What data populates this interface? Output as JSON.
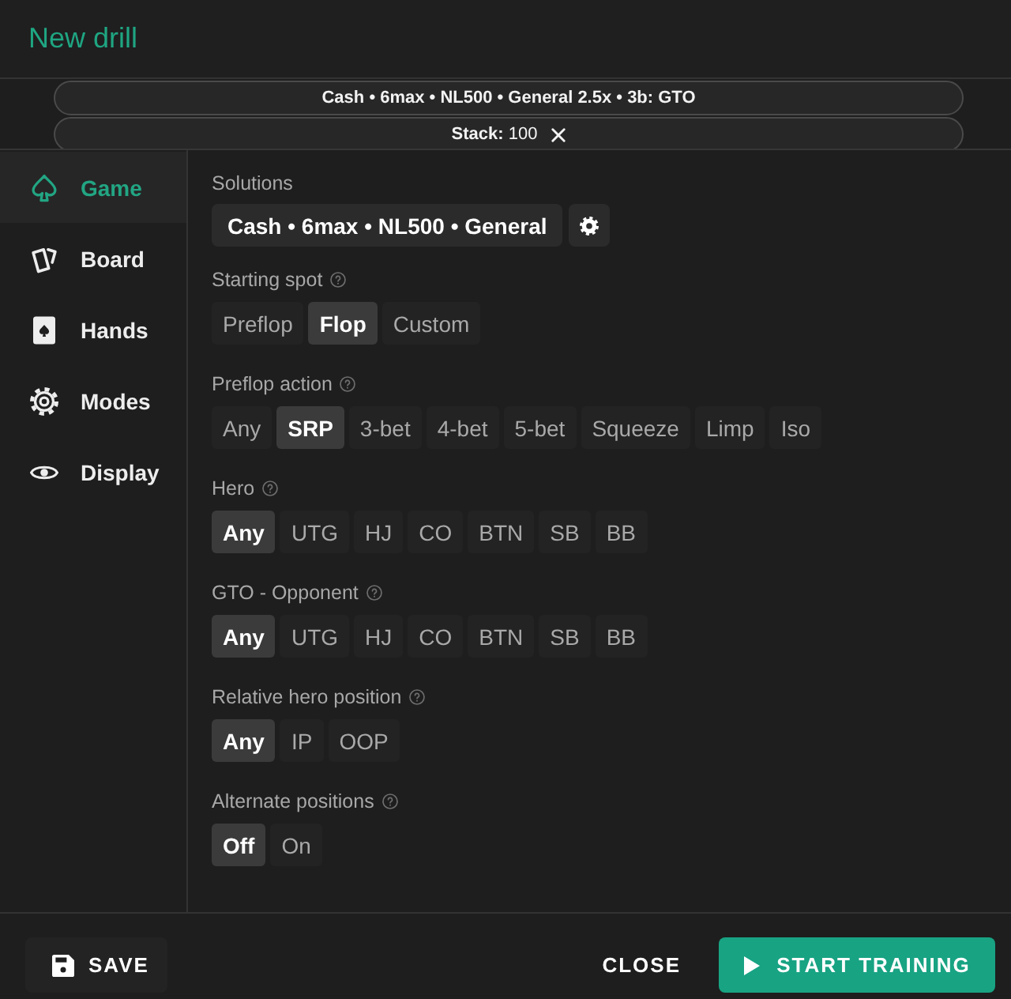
{
  "header": {
    "title": "New drill"
  },
  "filters": [
    {
      "label": "Cash • 6max • NL500 • General 2.5x • 3b: GTO",
      "removable": false
    },
    {
      "label": "Stack:",
      "value": "100",
      "removable": true
    }
  ],
  "sidebar": {
    "items": [
      {
        "label": "Game",
        "selected": true
      },
      {
        "label": "Board",
        "selected": false
      },
      {
        "label": "Hands",
        "selected": false
      },
      {
        "label": "Modes",
        "selected": false
      },
      {
        "label": "Display",
        "selected": false
      }
    ]
  },
  "solutions": {
    "label": "Solutions",
    "value": "Cash • 6max • NL500 • General"
  },
  "settings": [
    {
      "label": "Starting spot",
      "options": [
        {
          "label": "Preflop",
          "selected": false
        },
        {
          "label": "Flop",
          "selected": true
        },
        {
          "label": "Custom",
          "selected": false
        }
      ]
    },
    {
      "label": "Preflop action",
      "options": [
        {
          "label": "Any",
          "selected": false
        },
        {
          "label": "SRP",
          "selected": true
        },
        {
          "label": "3-bet",
          "selected": false
        },
        {
          "label": "4-bet",
          "selected": false
        },
        {
          "label": "5-bet",
          "selected": false
        },
        {
          "label": "Squeeze",
          "selected": false
        },
        {
          "label": "Limp",
          "selected": false
        },
        {
          "label": "Iso",
          "selected": false
        }
      ]
    },
    {
      "label": "Hero",
      "options": [
        {
          "label": "Any",
          "selected": true
        },
        {
          "label": "UTG",
          "selected": false
        },
        {
          "label": "HJ",
          "selected": false
        },
        {
          "label": "CO",
          "selected": false
        },
        {
          "label": "BTN",
          "selected": false
        },
        {
          "label": "SB",
          "selected": false
        },
        {
          "label": "BB",
          "selected": false
        }
      ]
    },
    {
      "label": "GTO - Opponent",
      "options": [
        {
          "label": "Any",
          "selected": true
        },
        {
          "label": "UTG",
          "selected": false
        },
        {
          "label": "HJ",
          "selected": false
        },
        {
          "label": "CO",
          "selected": false
        },
        {
          "label": "BTN",
          "selected": false
        },
        {
          "label": "SB",
          "selected": false
        },
        {
          "label": "BB",
          "selected": false
        }
      ]
    },
    {
      "label": "Relative hero position",
      "options": [
        {
          "label": "Any",
          "selected": true
        },
        {
          "label": "IP",
          "selected": false
        },
        {
          "label": "OOP",
          "selected": false
        }
      ]
    },
    {
      "label": "Alternate positions",
      "options": [
        {
          "label": "Off",
          "selected": true
        },
        {
          "label": "On",
          "selected": false
        }
      ]
    }
  ],
  "footer": {
    "buttons": [
      {
        "kind": "save",
        "label": "SAVE"
      },
      {
        "kind": "plain",
        "label": "CLOSE"
      },
      {
        "kind": "primary",
        "label": "START TRAINING"
      }
    ]
  }
}
